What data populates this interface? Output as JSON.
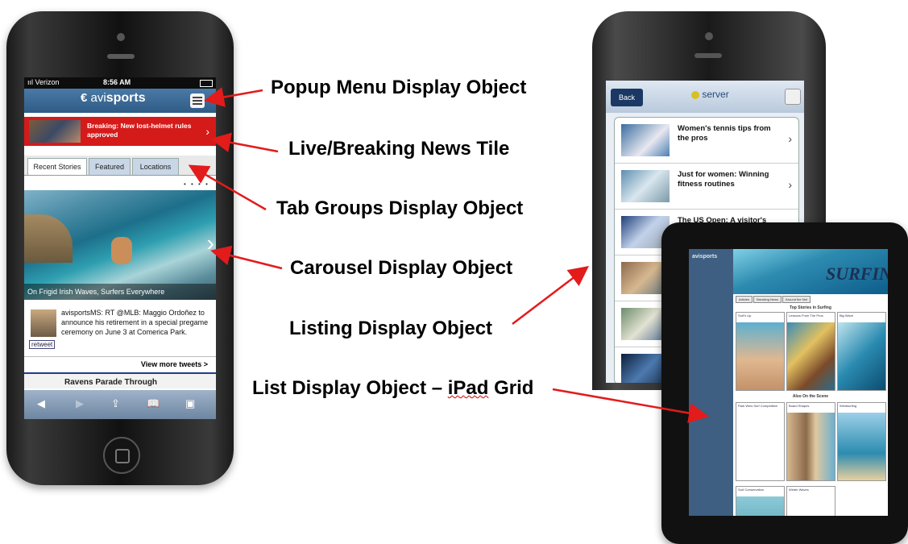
{
  "colors": {
    "arrow": "#e31b1b",
    "breaking_red": "#d51a1a",
    "nav_blue": "#2e5c86"
  },
  "phone_left": {
    "status": {
      "carrier": "ııl Verizon",
      "time": "8:56 AM"
    },
    "logo": {
      "prefix": "avi",
      "suffix": "sports"
    },
    "breaking_news": "Breaking: New lost-helmet rules approved",
    "tabs": [
      "Recent Stories",
      "Featured",
      "Locations"
    ],
    "carousel_caption": "On Frigid Irish Waves, Surfers Everywhere",
    "tweet": {
      "text": "avisportsMS: RT @MLB: Maggio Ordoñez to announce his retirement in a special pregame ceremony on June 3 at Comerica Park.",
      "retweet_label": "retweet"
    },
    "view_more": "View more tweets >",
    "next_story": "Ravens Parade Through",
    "toolbar_icons": [
      "back-icon",
      "forward-icon",
      "share-icon",
      "bookmarks-icon",
      "tabs-icon"
    ]
  },
  "phone_right": {
    "back_label": "Back",
    "logo_text": "server",
    "list_items": [
      "Women's tennis tips from the pros",
      "Just for women: Winning fitness routines",
      "The US Open: A visitor's",
      "",
      "",
      ""
    ]
  },
  "ipad": {
    "logo_text": "avisports",
    "banner_text": "SURFING",
    "tabs": [
      "Articles",
      "Breaking News",
      "Around the Net"
    ],
    "section1": "Top Stories in Surfing",
    "section2": "Also On the Scene",
    "tile_titles": [
      "Surf's Up",
      "Lessons From The Pros",
      "Big Wave",
      "Park Wins Surf Competition",
      "Board Shapes",
      "Windsurfing",
      "Surf Conservation",
      "Winter Waves"
    ]
  },
  "labels": {
    "popup_menu": "Popup Menu  Display Object",
    "live_news": "Live/Breaking News Tile",
    "tab_groups": "Tab Groups Display Object",
    "carousel": "Carousel Display Object",
    "listing": "Listing Display Object",
    "list_ipad_prefix": "List Display Object – ",
    "list_ipad_suffix": "iPad",
    "list_ipad_end": " Grid"
  }
}
